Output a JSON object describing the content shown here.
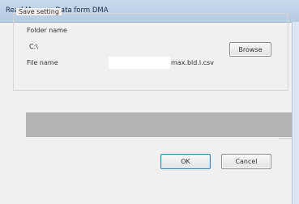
{
  "window": {
    "title": "Read Memory Data form DMA",
    "colors": {
      "titlebar": "#c9d9ec",
      "progress_track": "#b4b4b4",
      "button_focus_border": "#3c7fb1"
    }
  },
  "save_setting": {
    "group_label": "Save setting",
    "folder_label": "Folder name",
    "folder_value": "C:\\",
    "browse_label": "Browse",
    "file_label": "File name",
    "file_value": "",
    "file_suffix": "max.bld.l.csv"
  },
  "progress": {
    "value": 0
  },
  "buttons": {
    "ok_label": "OK",
    "cancel_label": "Cancel"
  }
}
